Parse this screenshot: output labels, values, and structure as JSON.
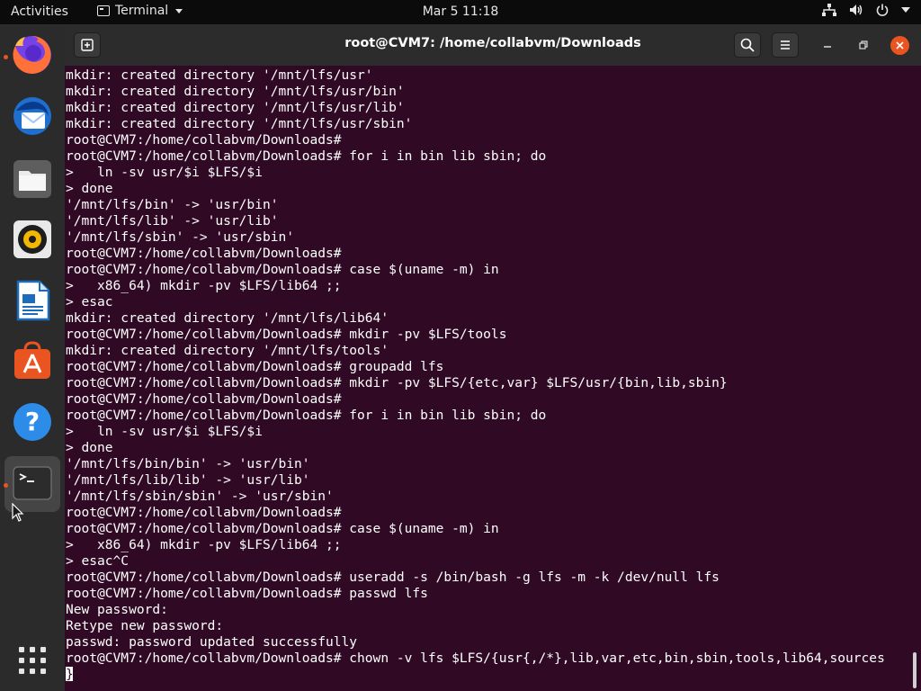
{
  "topbar": {
    "activities": "Activities",
    "app_name": "Terminal",
    "clock": "Mar 5  11:18",
    "tray_icons": [
      "network-icon",
      "volume-icon",
      "power-icon",
      "chevron-down-icon"
    ]
  },
  "dock": {
    "items": [
      {
        "name": "firefox",
        "icon": "firefox-icon",
        "running": true
      },
      {
        "name": "thunderbird",
        "icon": "thunderbird-icon",
        "running": false
      },
      {
        "name": "files",
        "icon": "files-icon",
        "running": false
      },
      {
        "name": "rhythmbox",
        "icon": "rhythmbox-icon",
        "running": false
      },
      {
        "name": "libreoffice-writer",
        "icon": "writer-icon",
        "running": false
      },
      {
        "name": "software",
        "icon": "software-icon",
        "running": false
      },
      {
        "name": "help",
        "icon": "help-icon",
        "running": false
      },
      {
        "name": "terminal",
        "icon": "terminal-icon",
        "running": true
      }
    ],
    "show_apps_icon": "grid-icon"
  },
  "window": {
    "title": "root@CVM7: /home/collabvm/Downloads",
    "colors": {
      "background": "#300a24",
      "titlebar": "#2c2c2c",
      "accent": "#e95420"
    }
  },
  "terminal": {
    "lines": [
      "mkdir: created directory '/mnt/lfs/usr'",
      "mkdir: created directory '/mnt/lfs/usr/bin'",
      "mkdir: created directory '/mnt/lfs/usr/lib'",
      "mkdir: created directory '/mnt/lfs/usr/sbin'",
      "root@CVM7:/home/collabvm/Downloads#",
      "root@CVM7:/home/collabvm/Downloads# for i in bin lib sbin; do",
      ">   ln -sv usr/$i $LFS/$i",
      "> done",
      "'/mnt/lfs/bin' -> 'usr/bin'",
      "'/mnt/lfs/lib' -> 'usr/lib'",
      "'/mnt/lfs/sbin' -> 'usr/sbin'",
      "root@CVM7:/home/collabvm/Downloads#",
      "root@CVM7:/home/collabvm/Downloads# case $(uname -m) in",
      ">   x86_64) mkdir -pv $LFS/lib64 ;;",
      "> esac",
      "mkdir: created directory '/mnt/lfs/lib64'",
      "root@CVM7:/home/collabvm/Downloads# mkdir -pv $LFS/tools",
      "mkdir: created directory '/mnt/lfs/tools'",
      "root@CVM7:/home/collabvm/Downloads# groupadd lfs",
      "root@CVM7:/home/collabvm/Downloads# mkdir -pv $LFS/{etc,var} $LFS/usr/{bin,lib,sbin}",
      "root@CVM7:/home/collabvm/Downloads#",
      "root@CVM7:/home/collabvm/Downloads# for i in bin lib sbin; do",
      ">   ln -sv usr/$i $LFS/$i",
      "> done",
      "'/mnt/lfs/bin/bin' -> 'usr/bin'",
      "'/mnt/lfs/lib/lib' -> 'usr/lib'",
      "'/mnt/lfs/sbin/sbin' -> 'usr/sbin'",
      "root@CVM7:/home/collabvm/Downloads#",
      "root@CVM7:/home/collabvm/Downloads# case $(uname -m) in",
      ">   x86_64) mkdir -pv $LFS/lib64 ;;",
      "> esac^C",
      "root@CVM7:/home/collabvm/Downloads# useradd -s /bin/bash -g lfs -m -k /dev/null lfs",
      "root@CVM7:/home/collabvm/Downloads# passwd lfs",
      "New password:",
      "Retype new password:",
      "passwd: password updated successfully",
      "root@CVM7:/home/collabvm/Downloads# chown -v lfs $LFS/{usr{,/*},lib,var,etc,bin,sbin,tools,lib64,sources",
      "}"
    ]
  }
}
